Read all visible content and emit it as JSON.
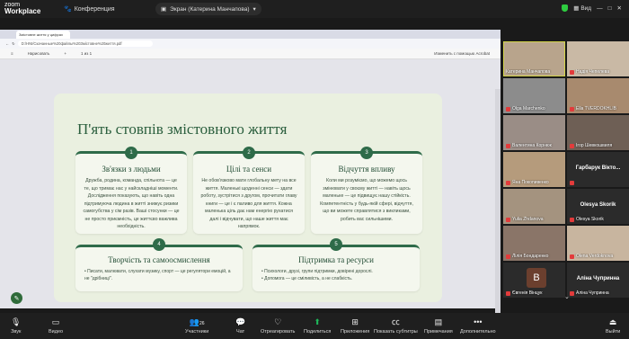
{
  "app": {
    "brand_top": "zoom",
    "brand_bottom": "Workplace"
  },
  "topbar": {
    "conference_label": "Конференция",
    "sharing_label": "Экран (Катерина Манчапова)",
    "view_label": "Вид"
  },
  "browser": {
    "tab_title": "Змістовне життя у цифрах",
    "url": "D:/HNI/Скачанные%20файлы%20Змістовне%20життя.pdf",
    "toolbar": {
      "contents": "Нарисовать",
      "page": "1 из 1",
      "zoom": "+",
      "right": "Изменить с помощью Acrobat"
    }
  },
  "slide": {
    "title": "П'ять стовпів змістовного життя",
    "cards": [
      {
        "num": "1",
        "title": "Зв'язки з людьми",
        "text": "Дружба, родина, команда, спільнота — це те, що тримає нас у найскладніші моменти. Дослідження показують, що навіть одна підтримуюча людина в житті знижує ризики самогубства у сім разів. Ваші стосунки — це не просто приємність, це життєво важлива необхідність."
      },
      {
        "num": "2",
        "title": "Цілі та сенси",
        "text": "Не обов'язково мати глобальну мету на все життя. Маленькі щоденні сенси — здати роботу, зустрітися з другом, прочитати главу книги — це і є паливо для життя. Кожна маленька ціль дає нам енергію рухатися далі і відчувати, що наше життя має напрямок."
      },
      {
        "num": "3",
        "title": "Відчуття впливу",
        "text": "Коли ми розуміємо, що можемо щось змінювати у своєму житті — навіть щось маленьке — це підвищує нашу стійкість. Компетентність у будь-якій сфері, відчуття, що ви можете справлятися з викликами, робить вас сильнішими."
      },
      {
        "num": "4",
        "title": "Творчість та самоосмислення",
        "bullets": [
          "Писати, малювати, слухати музику, спорт — це регулятори емоцій, а не \"дрібниці\"."
        ]
      },
      {
        "num": "5",
        "title": "Підтримка та ресурси",
        "bullets": [
          "Психологи, друзі, групи підтримки, довірені дорослі.",
          "Допомога — це сміливість, а не слабкість."
        ]
      }
    ]
  },
  "participants": [
    {
      "name": "Катерина Манчапова",
      "video": true,
      "muted": false,
      "active": true
    },
    {
      "name": "Надія Чепелева",
      "video": true,
      "muted": true
    },
    {
      "name": "Olga Marchenko",
      "video": true,
      "muted": true
    },
    {
      "name": "Ella TVERDOKHLIB",
      "video": true,
      "muted": true
    },
    {
      "name": "Валентина Корнюк",
      "video": true,
      "muted": true
    },
    {
      "name": "Ігор Шевкошвиля",
      "video": true,
      "muted": true
    },
    {
      "name": "Яна Покопивенко",
      "video": true,
      "muted": true
    },
    {
      "name": "Гарбарук Вікто...",
      "video": false,
      "muted": true,
      "display": "Гарбарук Вікто..."
    },
    {
      "name": "Yulia Zhdanova",
      "video": true,
      "muted": true
    },
    {
      "name": "Olesya Skorik",
      "video": false,
      "muted": true,
      "display": "Olesya Skorik"
    },
    {
      "name": "Лілія Бондаренко",
      "video": true,
      "muted": true
    },
    {
      "name": "Olena Verdoknova",
      "video": true,
      "muted": true
    },
    {
      "name": "Євгенія Вінцук",
      "video": false,
      "muted": true,
      "avatar": "В"
    },
    {
      "name": "Аліна Чупринна",
      "video": false,
      "muted": true,
      "display": "Аліна Чупринна"
    }
  ],
  "bottombar": {
    "audio": "Звук",
    "video": "Видео",
    "participants": "Участники",
    "participants_count": "26",
    "chat": "Чат",
    "react": "Отреагировать",
    "share": "Поделиться",
    "apps": "Приложения",
    "captions": "Показать субтитры",
    "notes": "Примечания",
    "more": "Дополнительно",
    "leave": "Выйти"
  }
}
